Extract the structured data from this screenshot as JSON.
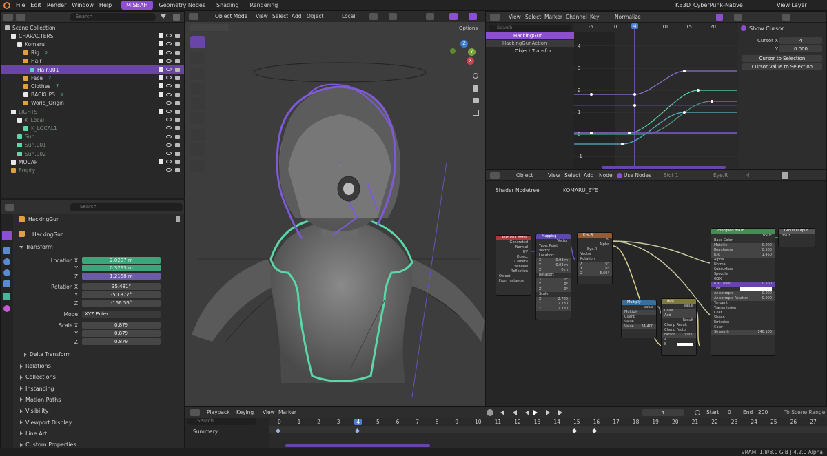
{
  "menu": [
    "File",
    "Edit",
    "Render",
    "Window",
    "Help"
  ],
  "workspaces": [
    {
      "label": "MISBAH",
      "active": true
    },
    {
      "label": "Geometry Nodes",
      "active": false
    },
    {
      "label": "Shading",
      "active": false
    },
    {
      "label": "Rendering",
      "active": false
    }
  ],
  "file_title": "KB3D_CyberPunk-Native",
  "view_layer": "View Layer",
  "outliner": {
    "search_placeholder": "Search",
    "rows": [
      {
        "label": "Scene Collection",
        "indent": 0,
        "type": "scene"
      },
      {
        "label": "CHARACTERS",
        "indent": 1,
        "type": "collection",
        "checks": true
      },
      {
        "label": "Komaru",
        "indent": 2,
        "type": "collection",
        "checks": true
      },
      {
        "label": "Rig",
        "indent": 3,
        "type": "object",
        "checks": true,
        "badge": "2"
      },
      {
        "label": "Hair",
        "indent": 3,
        "type": "object",
        "checks": true
      },
      {
        "label": "Hair.001",
        "indent": 4,
        "type": "mesh",
        "checks": true,
        "selected": true
      },
      {
        "label": "Face",
        "indent": 3,
        "type": "object",
        "checks": true,
        "badge": "2"
      },
      {
        "label": "Clothes",
        "indent": 3,
        "type": "object",
        "checks": true,
        "badge": "7"
      },
      {
        "label": "BACKUPS",
        "indent": 3,
        "type": "collection",
        "checks": true,
        "badge": "2"
      },
      {
        "label": "World_Origin",
        "indent": 3,
        "type": "empty",
        "checks": false
      },
      {
        "label": "LIGHTS",
        "indent": 1,
        "type": "collection",
        "checks": true,
        "dim": true
      },
      {
        "label": "K_Local",
        "indent": 2,
        "type": "collection",
        "checks": false,
        "dim": true
      },
      {
        "label": "K_LOCAL1",
        "indent": 3,
        "type": "light",
        "checks": false,
        "dim": true
      },
      {
        "label": "Sun",
        "indent": 2,
        "type": "light",
        "checks": false,
        "dim": true
      },
      {
        "label": "Sun.001",
        "indent": 2,
        "type": "light",
        "checks": false,
        "dim": true
      },
      {
        "label": "Sun.002",
        "indent": 2,
        "type": "light",
        "checks": false,
        "dim": true
      },
      {
        "label": "MOCAP",
        "indent": 1,
        "type": "collection",
        "checks": true
      },
      {
        "label": "Empty",
        "indent": 1,
        "type": "empty",
        "checks": false,
        "dim": true
      }
    ]
  },
  "properties": {
    "search_placeholder": "Search",
    "object_name": "HackingGun",
    "object_name2": "HackingGun",
    "transform_title": "Transform",
    "location_label": "Location X",
    "location": [
      "2.0297 m",
      "0.3293 m",
      "1.2158 m"
    ],
    "rotation_label": "Rotation X",
    "rotation": [
      "35.481°",
      "-50.877°",
      "-156.56°"
    ],
    "mode_label": "Mode",
    "mode_value": "XYZ Euler",
    "scale_label": "Scale X",
    "scale": [
      "0.879",
      "0.879",
      "0.879"
    ],
    "axis_y": "Y",
    "axis_z": "Z",
    "delta": "Delta Transform",
    "sections": [
      "Relations",
      "Collections",
      "Instancing",
      "Motion Paths",
      "Visibility",
      "Viewport Display",
      "Line Art",
      "Custom Properties"
    ]
  },
  "viewport": {
    "mode": "Object Mode",
    "menus": [
      "View",
      "Select",
      "Add",
      "Object"
    ],
    "orientation": "Local",
    "options": "Options",
    "axes": [
      "Z",
      "Y",
      "X"
    ]
  },
  "graph": {
    "menus": [
      "View",
      "Select",
      "Marker",
      "Channel",
      "Key"
    ],
    "normalize": "Normalize",
    "search_placeholder": "Search",
    "channels": [
      "HackingGun",
      "HackingGunAction",
      "Object Transfor"
    ],
    "frames": [
      "-5",
      "0",
      "4",
      "10",
      "15",
      "20"
    ],
    "yvals": [
      "4",
      "3",
      "2",
      "1",
      "0",
      "-1"
    ],
    "cursor_title": "Show Cursor",
    "cursor_x_label": "Cursor X",
    "cursor_x": "4",
    "cursor_y_label": "Y",
    "cursor_y": "0.000",
    "btn1": "Cursor to Selection",
    "btn2": "Cursor Value to Selection"
  },
  "nodes": {
    "object_label": "Object",
    "menus": [
      "View",
      "Select",
      "Add",
      "Node"
    ],
    "use_nodes": "Use Nodes",
    "slot": "Slot 1",
    "material": "Eye.R",
    "slot_count": "4",
    "breadcrumb1": "Shader Nodetree",
    "breadcrumb2": "KOMARU_EYE",
    "texcoord": {
      "title": "Texture Coordi..",
      "rows": [
        "Generated",
        "Normal",
        "UV",
        "Object",
        "Camera",
        "Window",
        "Reflection"
      ],
      "object_label": "Object",
      "from_instancer": "From Instancer"
    },
    "mapping": {
      "title": "Mapping",
      "vector": "Vector",
      "type_label": "Type:",
      "type_value": "Point",
      "vec_label": "Vector",
      "loc": "Location:",
      "lx": "-0.08 m",
      "ly": "-0.02 m",
      "lz": "0 m",
      "rot": "Rotation:",
      "rx": "0°",
      "ry": "0°",
      "rz": "0°",
      "scale": "Scale:",
      "sx": "2.780",
      "sy": "2.780",
      "sz": "2.780",
      "x": "X",
      "y": "Y",
      "z": "Z"
    },
    "eyer": {
      "title": "Eye.R",
      "col": "Col",
      "alpha": "Alpha",
      "img": "Eye.R",
      "vector": "Vector",
      "rot": "Rotation:",
      "rx": "0°",
      "ry": "0°",
      "rz": "5.60°",
      "x": "X",
      "y": "Y",
      "z": "Z"
    },
    "multiply": {
      "title": "Multiply",
      "value": "Value",
      "op": "Multiply",
      "clamp": "Clamp",
      "value_in": "Value",
      "value_num": "34.400"
    },
    "add": {
      "title": "Add",
      "value": "Value",
      "color": "Color",
      "op": "Add",
      "result": "Result",
      "clamp_result": "Clamp Result",
      "clamp_factor": "Clamp Factor",
      "factor": "Factor",
      "factor_val": "0.000",
      "a": "A",
      "b": "B"
    },
    "principled": {
      "title": "Principled BSDF",
      "bsdf": "BSDF",
      "rows": [
        "Base Color",
        "Metallic",
        "Roughness",
        "IOR",
        "Alpha",
        "Normal",
        "Subsurface",
        "Specular",
        "GGX",
        "IOR Level",
        "Tint",
        "Anisotropic",
        "Anisotropic Rotation",
        "Tangent",
        "Transmission",
        "Coat",
        "Sheen",
        "Emission",
        "Color",
        "Strength"
      ],
      "metallic": "0.000",
      "roughness": "0.500",
      "ior": "1.450",
      "ior_level": "0.500",
      "aniso": "0.000",
      "aniso_rot": "0.000",
      "strength": "140.100"
    },
    "output": {
      "title": "Group Output",
      "bsdf": "BSDF"
    }
  },
  "timeline": {
    "menus": [
      "Playback",
      "Keying",
      "View",
      "Marker"
    ],
    "current_frame": "4",
    "start_label": "Start",
    "start": "0",
    "end_label": "End",
    "end": "200",
    "to_scene": "To Scene Range",
    "search_placeholder": "Search",
    "summary": "Summary",
    "frames": [
      "0",
      "1",
      "2",
      "3",
      "4",
      "5",
      "6",
      "7",
      "8",
      "9",
      "10",
      "11",
      "12",
      "13",
      "14",
      "15",
      "16",
      "17",
      "18",
      "19",
      "20",
      "21",
      "22",
      "23",
      "24",
      "25",
      "26",
      "27"
    ]
  },
  "status": "VRAM: 1.8/8.0 GiB | 4.2.0 Alpha",
  "colors": {
    "accent": "#8d4fd1",
    "location": "#3ea57a",
    "y": "#6c5ba7",
    "outline": "#7d5ad6",
    "teal": "#5ad8a8"
  }
}
